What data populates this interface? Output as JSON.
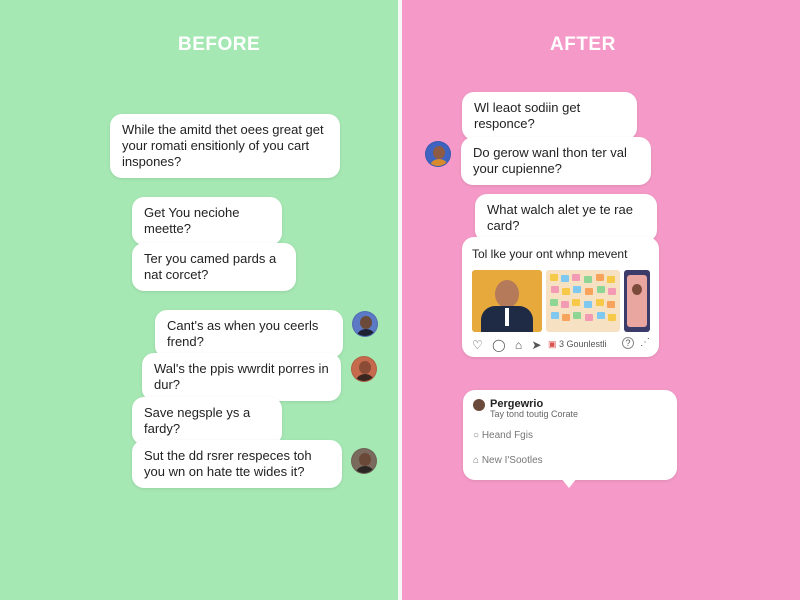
{
  "before": {
    "heading": "BEFORE",
    "messages": [
      "While the amitd thet oees great get your romati ensitionly of you cart inspones?",
      "Get You neciohe meette?",
      "Ter you camed pards a nat corcet?",
      "Cant's as when you ceerls frend?",
      "Wal's the ppis wwrdit porres in dur?",
      "Save negsple ys a fardy?",
      "Sut the dd rsrer respeces toh you wn on hate tte wides it?"
    ]
  },
  "after": {
    "heading": "AFTER",
    "messages": [
      "Wl leaot sodiin get responce?",
      "Do gerow wanl thon ter val your cupienne?",
      "What walch alet ye te rae card?"
    ],
    "feed_card": {
      "title": "Tol lke your ont whnp mevent",
      "footer_text": "3 Gounlestli",
      "help_label": "?"
    },
    "menu_card": {
      "name": "Pergewrio",
      "subtitle": "Tay tond toutig Corate",
      "items": [
        "Heand Fgis",
        "New I'Sootles"
      ]
    }
  },
  "colors": {
    "before_bg": "#a6e8b4",
    "after_bg": "#f59ac8"
  }
}
